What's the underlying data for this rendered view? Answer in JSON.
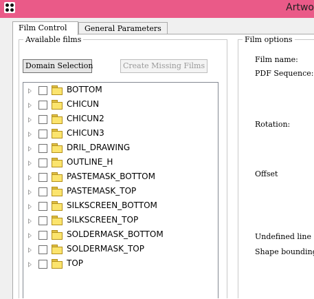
{
  "window": {
    "title": "Artwo"
  },
  "tabs": [
    {
      "label": "Film Control",
      "active": true
    },
    {
      "label": "General Parameters",
      "active": false
    }
  ],
  "available_films": {
    "legend": "Available films",
    "domain_button": "Domain Selection",
    "create_button": "Create Missing Films",
    "films": [
      "BOTTOM",
      "CHICUN",
      "CHICUN2",
      "CHICUN3",
      "DRIL_DRAWING",
      "OUTLINE_H",
      "PASTEMASK_BOTTOM",
      "PASTEMASK_TOP",
      "SILKSCREEN_BOTTOM",
      "SILKSCREEN_TOP",
      "SOLDERMASK_BOTTOM",
      "SOLDERMASK_TOP",
      "TOP"
    ]
  },
  "film_options": {
    "legend": "Film options",
    "film_name_label": "Film name:",
    "pdf_sequence_label": "PDF Sequence:",
    "rotation_label": "Rotation:",
    "offset_label": "Offset",
    "undefined_line_label": "Undefined line",
    "shape_bounding_label": "Shape bounding"
  },
  "colors": {
    "titlebar": "#ea5a88",
    "folder": "#fbe46d"
  }
}
